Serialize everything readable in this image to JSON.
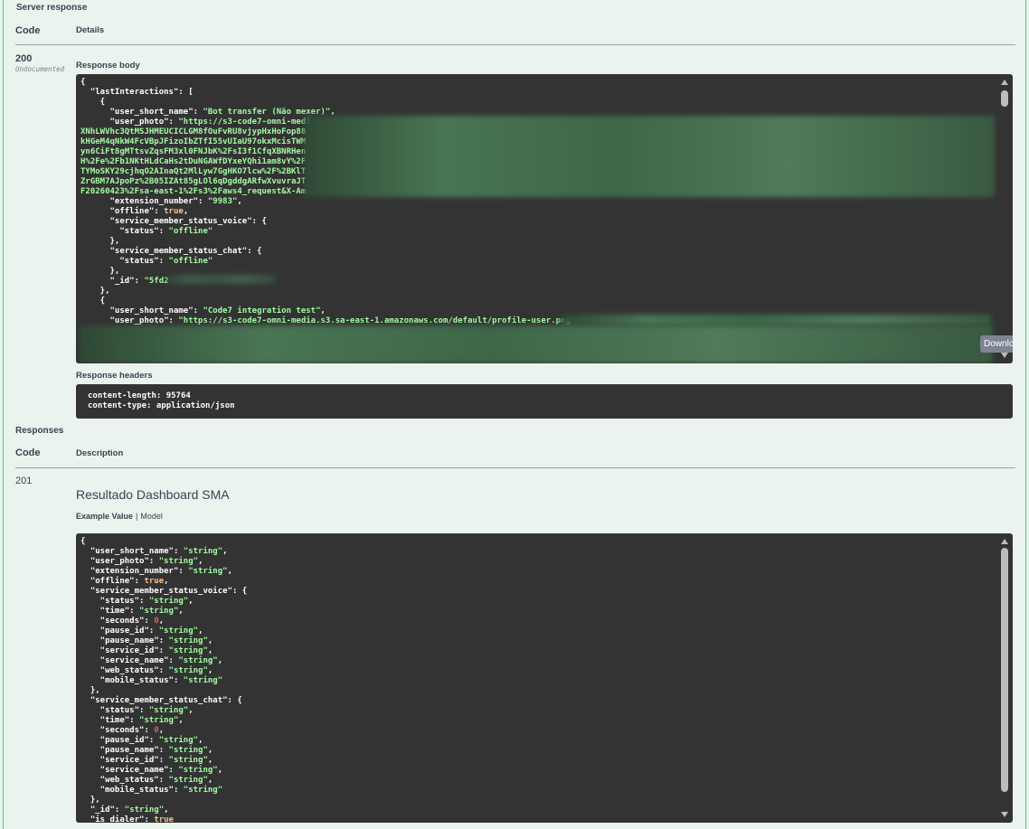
{
  "server_response": {
    "title": "Server response",
    "col_code": "Code",
    "col_details": "Details",
    "status_code": "200",
    "status_note": "Undocumented",
    "body_label": "Response body",
    "headers_label": "Response headers",
    "headers_text": "content-length: 95764\ncontent-type: application/json",
    "download_label": "Download"
  },
  "responses": {
    "title": "Responses",
    "col_code": "Code",
    "col_description": "Description",
    "code": "201",
    "description": "Resultado Dashboard SMA",
    "tab_example": "Example Value",
    "tab_model": "Model"
  },
  "colors": {
    "accent": "#49cc90",
    "code_bg": "#333333",
    "string": "#a2fca2",
    "number": "#d36363",
    "bool": "#fcc28c"
  }
}
